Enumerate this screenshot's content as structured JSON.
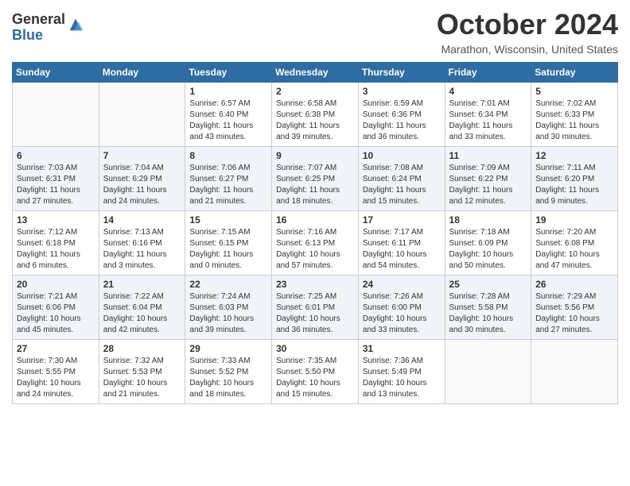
{
  "header": {
    "logo_general": "General",
    "logo_blue": "Blue",
    "month_title": "October 2024",
    "location": "Marathon, Wisconsin, United States"
  },
  "days_of_week": [
    "Sunday",
    "Monday",
    "Tuesday",
    "Wednesday",
    "Thursday",
    "Friday",
    "Saturday"
  ],
  "weeks": [
    {
      "days": [
        {
          "num": "",
          "empty": true
        },
        {
          "num": "",
          "empty": true
        },
        {
          "num": "1",
          "sunrise": "6:57 AM",
          "sunset": "6:40 PM",
          "daylight": "11 hours and 43 minutes."
        },
        {
          "num": "2",
          "sunrise": "6:58 AM",
          "sunset": "6:38 PM",
          "daylight": "11 hours and 39 minutes."
        },
        {
          "num": "3",
          "sunrise": "6:59 AM",
          "sunset": "6:36 PM",
          "daylight": "11 hours and 36 minutes."
        },
        {
          "num": "4",
          "sunrise": "7:01 AM",
          "sunset": "6:34 PM",
          "daylight": "11 hours and 33 minutes."
        },
        {
          "num": "5",
          "sunrise": "7:02 AM",
          "sunset": "6:33 PM",
          "daylight": "11 hours and 30 minutes."
        }
      ]
    },
    {
      "days": [
        {
          "num": "6",
          "sunrise": "7:03 AM",
          "sunset": "6:31 PM",
          "daylight": "11 hours and 27 minutes."
        },
        {
          "num": "7",
          "sunrise": "7:04 AM",
          "sunset": "6:29 PM",
          "daylight": "11 hours and 24 minutes."
        },
        {
          "num": "8",
          "sunrise": "7:06 AM",
          "sunset": "6:27 PM",
          "daylight": "11 hours and 21 minutes."
        },
        {
          "num": "9",
          "sunrise": "7:07 AM",
          "sunset": "6:25 PM",
          "daylight": "11 hours and 18 minutes."
        },
        {
          "num": "10",
          "sunrise": "7:08 AM",
          "sunset": "6:24 PM",
          "daylight": "11 hours and 15 minutes."
        },
        {
          "num": "11",
          "sunrise": "7:09 AM",
          "sunset": "6:22 PM",
          "daylight": "11 hours and 12 minutes."
        },
        {
          "num": "12",
          "sunrise": "7:11 AM",
          "sunset": "6:20 PM",
          "daylight": "11 hours and 9 minutes."
        }
      ]
    },
    {
      "days": [
        {
          "num": "13",
          "sunrise": "7:12 AM",
          "sunset": "6:18 PM",
          "daylight": "11 hours and 6 minutes."
        },
        {
          "num": "14",
          "sunrise": "7:13 AM",
          "sunset": "6:16 PM",
          "daylight": "11 hours and 3 minutes."
        },
        {
          "num": "15",
          "sunrise": "7:15 AM",
          "sunset": "6:15 PM",
          "daylight": "11 hours and 0 minutes."
        },
        {
          "num": "16",
          "sunrise": "7:16 AM",
          "sunset": "6:13 PM",
          "daylight": "10 hours and 57 minutes."
        },
        {
          "num": "17",
          "sunrise": "7:17 AM",
          "sunset": "6:11 PM",
          "daylight": "10 hours and 54 minutes."
        },
        {
          "num": "18",
          "sunrise": "7:18 AM",
          "sunset": "6:09 PM",
          "daylight": "10 hours and 50 minutes."
        },
        {
          "num": "19",
          "sunrise": "7:20 AM",
          "sunset": "6:08 PM",
          "daylight": "10 hours and 47 minutes."
        }
      ]
    },
    {
      "days": [
        {
          "num": "20",
          "sunrise": "7:21 AM",
          "sunset": "6:06 PM",
          "daylight": "10 hours and 45 minutes."
        },
        {
          "num": "21",
          "sunrise": "7:22 AM",
          "sunset": "6:04 PM",
          "daylight": "10 hours and 42 minutes."
        },
        {
          "num": "22",
          "sunrise": "7:24 AM",
          "sunset": "6:03 PM",
          "daylight": "10 hours and 39 minutes."
        },
        {
          "num": "23",
          "sunrise": "7:25 AM",
          "sunset": "6:01 PM",
          "daylight": "10 hours and 36 minutes."
        },
        {
          "num": "24",
          "sunrise": "7:26 AM",
          "sunset": "6:00 PM",
          "daylight": "10 hours and 33 minutes."
        },
        {
          "num": "25",
          "sunrise": "7:28 AM",
          "sunset": "5:58 PM",
          "daylight": "10 hours and 30 minutes."
        },
        {
          "num": "26",
          "sunrise": "7:29 AM",
          "sunset": "5:56 PM",
          "daylight": "10 hours and 27 minutes."
        }
      ]
    },
    {
      "days": [
        {
          "num": "27",
          "sunrise": "7:30 AM",
          "sunset": "5:55 PM",
          "daylight": "10 hours and 24 minutes."
        },
        {
          "num": "28",
          "sunrise": "7:32 AM",
          "sunset": "5:53 PM",
          "daylight": "10 hours and 21 minutes."
        },
        {
          "num": "29",
          "sunrise": "7:33 AM",
          "sunset": "5:52 PM",
          "daylight": "10 hours and 18 minutes."
        },
        {
          "num": "30",
          "sunrise": "7:35 AM",
          "sunset": "5:50 PM",
          "daylight": "10 hours and 15 minutes."
        },
        {
          "num": "31",
          "sunrise": "7:36 AM",
          "sunset": "5:49 PM",
          "daylight": "10 hours and 13 minutes."
        },
        {
          "num": "",
          "empty": true
        },
        {
          "num": "",
          "empty": true
        }
      ]
    }
  ]
}
